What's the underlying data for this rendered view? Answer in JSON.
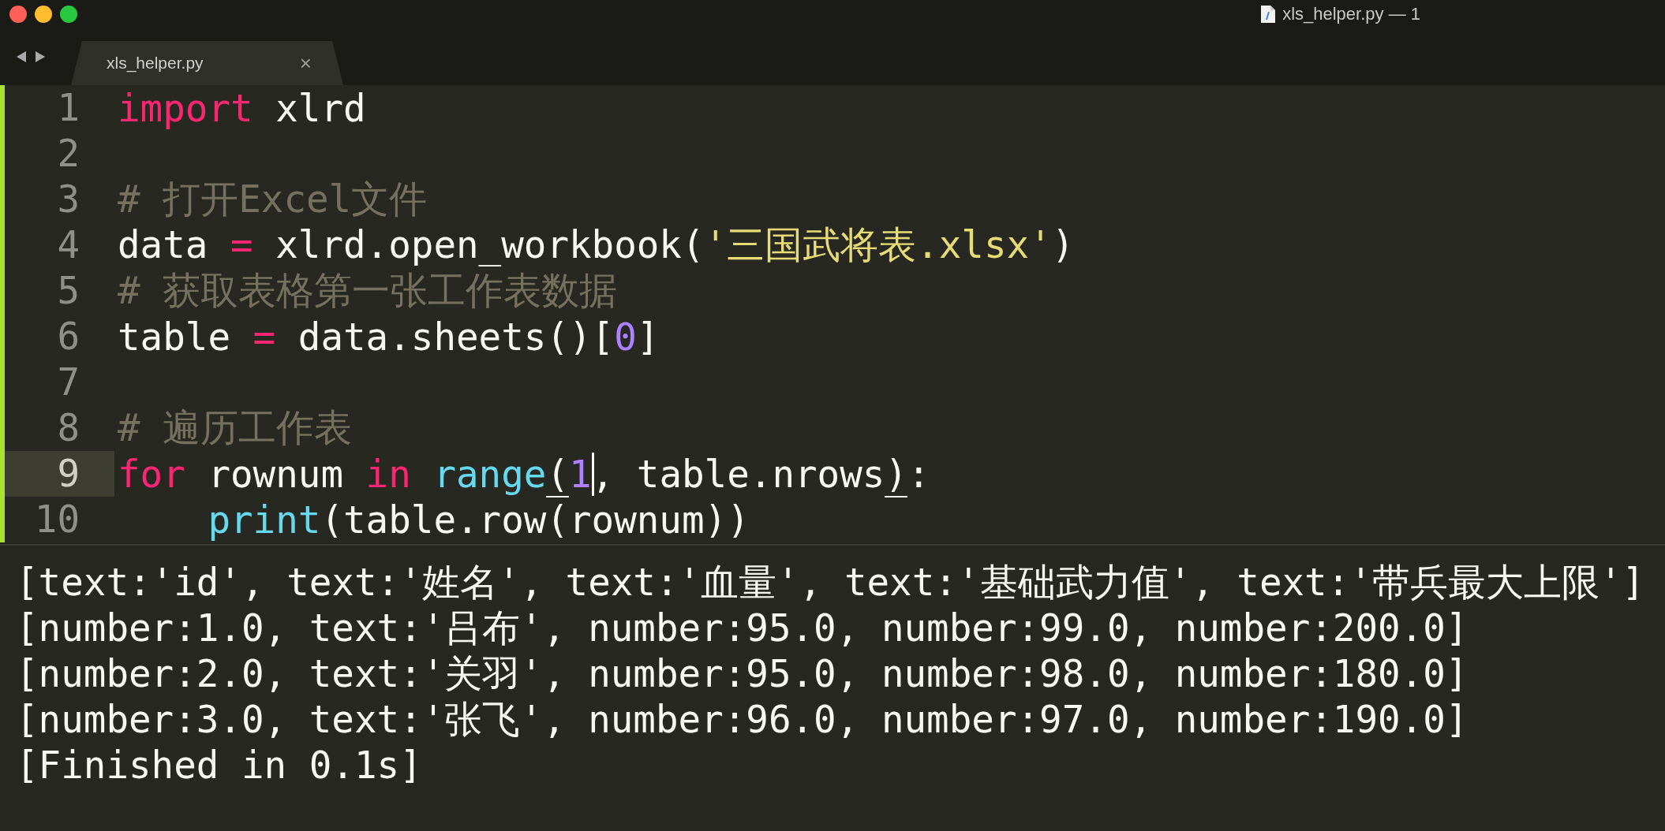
{
  "window": {
    "title": "xls_helper.py — 1"
  },
  "tabs": [
    {
      "label": "xls_helper.py",
      "selected": true,
      "close": "×"
    }
  ],
  "code": {
    "lines": [
      {
        "number": "1",
        "current": false,
        "tokens": [
          {
            "kind": "keyword",
            "text": "import"
          },
          {
            "kind": "plain",
            "text": " xlrd"
          }
        ]
      },
      {
        "number": "2",
        "current": false
      },
      {
        "number": "3",
        "current": false,
        "tokens": [
          {
            "kind": "comment",
            "text": "# 打开Excel文件"
          }
        ]
      },
      {
        "number": "4",
        "current": false,
        "tokens": [
          {
            "kind": "plain",
            "text": "data "
          },
          {
            "kind": "keyword",
            "text": "="
          },
          {
            "kind": "plain",
            "text": " xlrd.open_workbook("
          },
          {
            "kind": "string",
            "text": "'三国武将表.xlsx'"
          },
          {
            "kind": "plain",
            "text": ")"
          }
        ]
      },
      {
        "number": "5",
        "current": false,
        "tokens": [
          {
            "kind": "comment",
            "text": "# 获取表格第一张工作表数据"
          }
        ]
      },
      {
        "number": "6",
        "current": false,
        "tokens": [
          {
            "kind": "plain",
            "text": "table "
          },
          {
            "kind": "keyword",
            "text": "="
          },
          {
            "kind": "plain",
            "text": " data.sheets()["
          },
          {
            "kind": "number",
            "text": "0"
          },
          {
            "kind": "plain",
            "text": "]"
          }
        ]
      },
      {
        "number": "7",
        "current": false
      },
      {
        "number": "8",
        "current": false,
        "tokens": [
          {
            "kind": "comment",
            "text": "# 遍历工作表"
          }
        ]
      },
      {
        "number": "9",
        "current": true,
        "tokens": [
          {
            "kind": "keyword",
            "text": "for"
          },
          {
            "kind": "plain",
            "text": " rownum "
          },
          {
            "kind": "keyword",
            "text": "in "
          },
          {
            "kind": "builtin",
            "text": "range"
          },
          {
            "kind": "matched",
            "text": "("
          },
          {
            "kind": "number",
            "text": "1"
          },
          {
            "kind": "caret",
            "text": ","
          },
          {
            "kind": "plain",
            "text": " table.nrows"
          },
          {
            "kind": "matched",
            "text": ")"
          },
          {
            "kind": "plain",
            "text": ":"
          }
        ]
      },
      {
        "number": "10",
        "current": false,
        "tokens": [
          {
            "kind": "builtin",
            "text": "    print"
          },
          {
            "kind": "plain",
            "text": "(table.row(rownum))"
          }
        ]
      }
    ]
  },
  "output": {
    "lines": [
      "[text:'id', text:'姓名', text:'血量', text:'基础武力值', text:'带兵最大上限']",
      "[number:1.0, text:'吕布', number:95.0, number:99.0, number:200.0]",
      "[number:2.0, text:'关羽', number:95.0, number:98.0, number:180.0]",
      "[number:3.0, text:'张飞', number:96.0, number:97.0, number:190.0]",
      "[Finished in 0.1s]"
    ]
  }
}
